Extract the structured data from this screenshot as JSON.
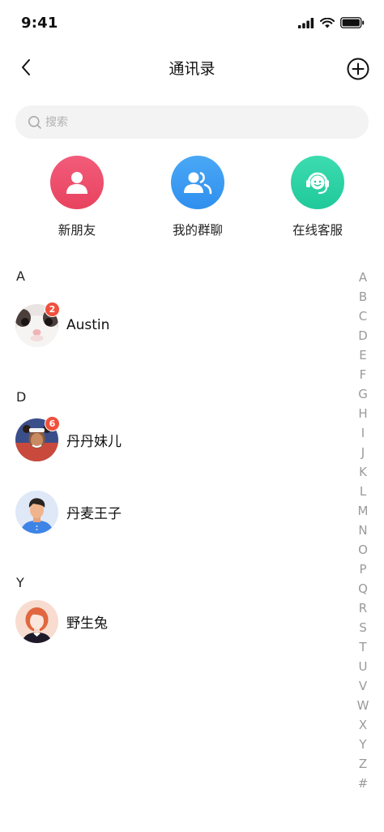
{
  "status": {
    "time": "9:41"
  },
  "nav": {
    "title": "通讯录"
  },
  "search": {
    "placeholder": "搜索"
  },
  "quick_actions": [
    {
      "label": "新朋友",
      "color": "#ec4d6c",
      "icon": "person-icon"
    },
    {
      "label": "我的群聊",
      "color": "#3a9cf2",
      "icon": "group-icon"
    },
    {
      "label": "在线客服",
      "color": "#2ad3a5",
      "icon": "headset-icon"
    }
  ],
  "sections": [
    {
      "letter": "A",
      "contacts": [
        {
          "name": "Austin",
          "badge": "2"
        }
      ]
    },
    {
      "letter": "D",
      "contacts": [
        {
          "name": "丹丹妹儿",
          "badge": "6"
        },
        {
          "name": "丹麦王子",
          "badge": ""
        }
      ]
    },
    {
      "letter": "Y",
      "contacts": [
        {
          "name": "野生兔",
          "badge": ""
        }
      ]
    }
  ],
  "index_letters": [
    "A",
    "B",
    "C",
    "D",
    "E",
    "F",
    "G",
    "H",
    "I",
    "J",
    "K",
    "L",
    "M",
    "N",
    "O",
    "P",
    "Q",
    "R",
    "S",
    "T",
    "U",
    "V",
    "W",
    "X",
    "Y",
    "Z",
    "#"
  ]
}
